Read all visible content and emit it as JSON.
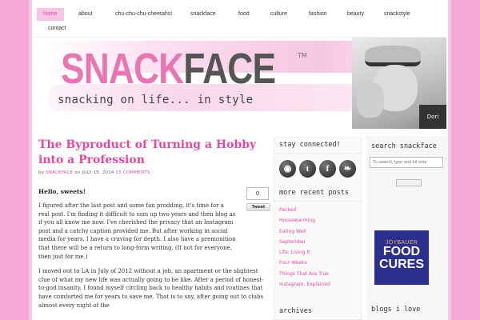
{
  "nav": {
    "items": [
      {
        "label": "home",
        "active": true
      },
      {
        "label": "about"
      },
      {
        "label": "chu-chu-chu-cheetahs!"
      },
      {
        "label": "snackface"
      },
      {
        "label": "food"
      },
      {
        "label": "culture"
      },
      {
        "label": "fashion"
      },
      {
        "label": "beauty"
      },
      {
        "label": "snackstyle"
      },
      {
        "label": "contact"
      }
    ]
  },
  "header": {
    "logo_part1": "SNACK",
    "logo_part2": "FACE",
    "tm": "TM",
    "tagline": "snacking on life... in style",
    "photo_label": "Dori"
  },
  "post": {
    "title": "The Byproduct of Turning a Hobby into a Profession",
    "byline_prefix": "by",
    "author": "SNACKFACE",
    "byline_on": "on",
    "date": "JULY 15, 2014",
    "comments": "15 COMMENTS",
    "greeting": "Hello, sweets!",
    "paragraph1": "I figured after the last post and some fan prodding, it's time for a real post. I'm finding it difficult to sum up two years and then blog as if you all know me now. I've cherished the privacy that an Instagram post and a catchy caption provided me. But after working in social media for years, I have a craving for depth. I also have a premonition that there will be a return to long-form writing. (If not for everyone, then just for me.)",
    "paragraph2": "I moved out to LA in July of 2012 without a job, an apartment or the slightest clue of what my new life was actually going to be like. After a period of honest-to-god insanity, I found myself circling back to healthy habits and routines that have comforted me for years to save me. That is to say, after going out to clubs almost every night of the"
  },
  "share": {
    "count": "0",
    "tweet_label": "Tweet"
  },
  "sidebar": {
    "stay_connected": "stay connected!",
    "social": [
      {
        "icon": "rss-icon",
        "glyph": "◉"
      },
      {
        "icon": "tumblr-icon",
        "glyph": "t"
      },
      {
        "icon": "facebook-icon",
        "glyph": "f"
      },
      {
        "icon": "twitter-icon",
        "glyph": "❧"
      }
    ],
    "recent_title": "more recent posts",
    "recent": [
      "Packed",
      "Housewarming",
      "Eating Well",
      "September",
      "Life: Living It",
      "Four Weeks",
      "Things That Are True",
      "Instagram, Explained"
    ],
    "archives_title": "archives"
  },
  "rsidebar": {
    "search_title": "search snackface",
    "search_placeholder": "To search, type and hit ente",
    "ad_line1": "JOYBAUER",
    "ad_line2": "FOOD",
    "ad_line3": "CURES",
    "blogs_title": "blogs i love"
  },
  "colors": {
    "accent": "#e8489c",
    "page_bg": "#f4a8d6"
  }
}
